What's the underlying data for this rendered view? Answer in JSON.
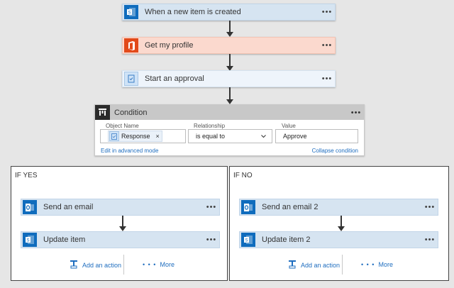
{
  "flow": {
    "trigger": {
      "label": "When a new item is created",
      "icon": "sharepoint-icon",
      "menu": "•••"
    },
    "profile": {
      "label": "Get my profile",
      "icon": "office365-icon",
      "menu": "•••"
    },
    "approval": {
      "label": "Start an approval",
      "icon": "approval-icon",
      "menu": "•••"
    },
    "condition": {
      "title": "Condition",
      "menu": "•••",
      "object_name_label": "Object Name",
      "object_value": "Response",
      "chip_remove": "×",
      "relationship_label": "Relationship",
      "relationship_value": "is equal to",
      "value_label": "Value",
      "value": "Approve",
      "edit_link": "Edit in advanced mode",
      "collapse_link": "Collapse condition"
    },
    "if_yes": {
      "title": "IF YES",
      "actions": [
        {
          "label": "Send an email",
          "menu": "•••"
        },
        {
          "label": "Update item",
          "menu": "•••"
        }
      ],
      "add_action": "Add an action",
      "more": "More",
      "more_dots": "• • •"
    },
    "if_no": {
      "title": "IF NO",
      "actions": [
        {
          "label": "Send an email 2",
          "menu": "•••"
        },
        {
          "label": "Update item 2",
          "menu": "•••"
        }
      ],
      "add_action": "Add an action",
      "more": "More",
      "more_dots": "• • •"
    }
  },
  "colors": {
    "background": "#e6e6e6",
    "sharepoint": "#0f6cbd",
    "office": "#e24a1a",
    "link": "#1e6dbf",
    "step_blue": "#d6e4f1",
    "step_salmon": "#fbd9ce"
  }
}
